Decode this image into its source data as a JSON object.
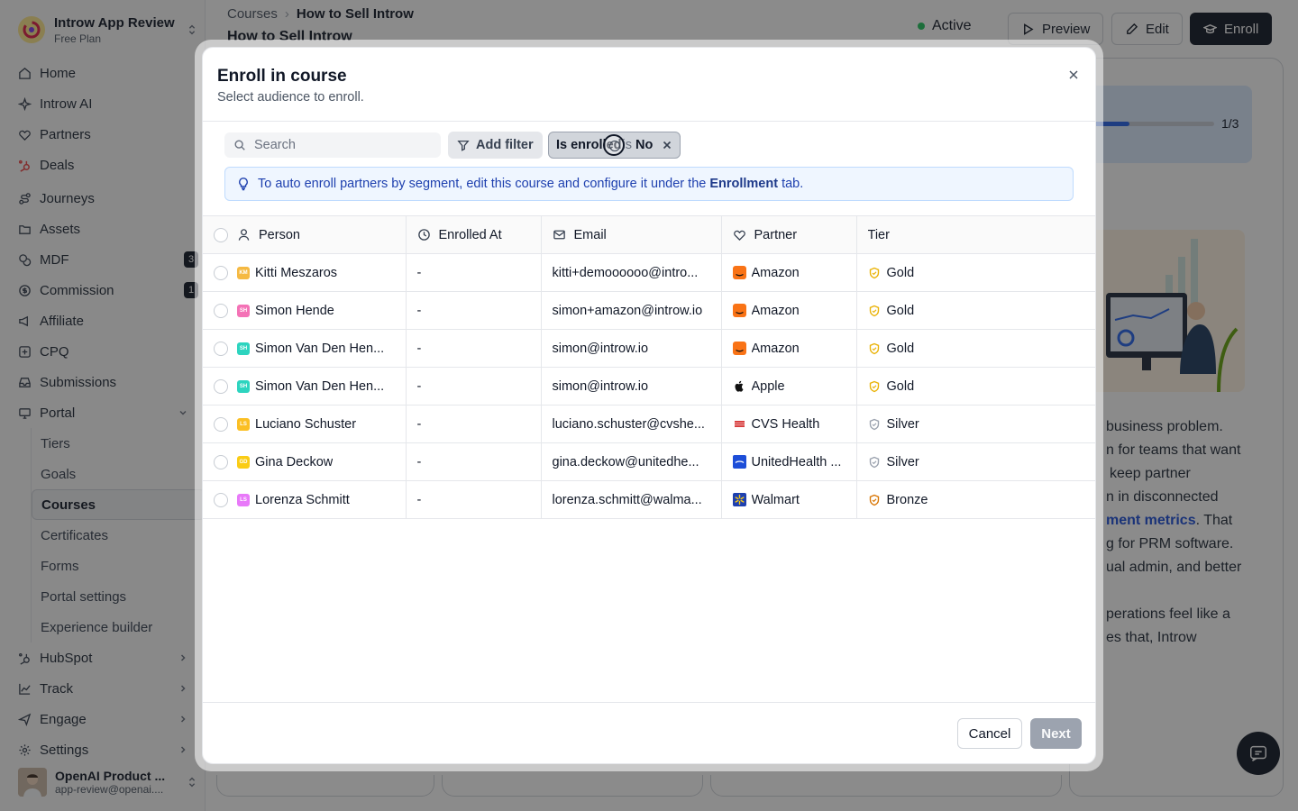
{
  "workspace": {
    "name": "Introw App Review",
    "plan": "Free Plan"
  },
  "sidebar": {
    "items": [
      {
        "label": "Home",
        "icon": "home-icon"
      },
      {
        "label": "Introw AI",
        "icon": "sparkle-icon"
      },
      {
        "label": "Partners",
        "icon": "handshake-icon"
      },
      {
        "label": "Deals",
        "icon": "hubspot-icon"
      },
      {
        "label": "Journeys",
        "icon": "route-icon"
      },
      {
        "label": "Assets",
        "icon": "folder-icon"
      },
      {
        "label": "MDF",
        "icon": "coins-icon",
        "badge": "3"
      },
      {
        "label": "Commission",
        "icon": "dollar-icon",
        "badge": "1"
      },
      {
        "label": "Affiliate",
        "icon": "megaphone-icon"
      },
      {
        "label": "CPQ",
        "icon": "cpq-icon"
      },
      {
        "label": "Submissions",
        "icon": "inbox-icon"
      },
      {
        "label": "Portal",
        "icon": "monitor-icon"
      }
    ],
    "portal_sub": [
      "Tiers",
      "Goals",
      "Courses",
      "Certificates",
      "Forms",
      "Portal settings",
      "Experience builder"
    ],
    "bottom_items": [
      {
        "label": "HubSpot",
        "icon": "hubspot-icon"
      },
      {
        "label": "Track",
        "icon": "chart-icon"
      },
      {
        "label": "Engage",
        "icon": "send-icon"
      },
      {
        "label": "Settings",
        "icon": "gear-icon"
      }
    ],
    "user": {
      "name": "OpenAI Product ...",
      "email": "app-review@openai...."
    }
  },
  "header": {
    "breadcrumb_root": "Courses",
    "breadcrumb_current": "How to Sell Introw",
    "title": "How to Sell Introw",
    "status": "Active",
    "preview_label": "Preview",
    "edit_label": "Edit",
    "enroll_label": "Enroll"
  },
  "background": {
    "progress_label": "1/3",
    "progress": 0.33,
    "lines": [
      "business problem.",
      "n for teams that want",
      "keep partner",
      "n in disconnected"
    ],
    "line5_link": "ment metrics",
    "line5_rest": ". That",
    "lines_after": [
      "g for PRM software.",
      "ual admin, and better",
      "",
      "perations feel like a",
      "es that, Introw"
    ]
  },
  "modal": {
    "title": "Enroll in course",
    "subtitle": "Select audience to enroll.",
    "search_placeholder": "Search",
    "add_filter_label": "Add filter",
    "filter": {
      "key": "Is enrolled",
      "op": "is",
      "value": "No"
    },
    "info_prefix": "To auto enroll partners by segment, edit this course and configure it under the",
    "info_link": "Enrollment",
    "info_suffix": "tab.",
    "columns": [
      "Person",
      "Enrolled At",
      "Email",
      "Partner",
      "Tier"
    ],
    "rows": [
      {
        "initials": "KM",
        "color": "#f5b942",
        "person": "Kitti Meszaros",
        "enrolled": "-",
        "email": "kitti+demoooooo@intro...",
        "partner": "Amazon",
        "plogo": "amazon",
        "tier": "Gold"
      },
      {
        "initials": "SH",
        "color": "#f472b6",
        "person": "Simon Hende",
        "enrolled": "-",
        "email": "simon+amazon@introw.io",
        "partner": "Amazon",
        "plogo": "amazon",
        "tier": "Gold"
      },
      {
        "initials": "SH",
        "color": "#2dd4bf",
        "person": "Simon Van Den Hen...",
        "enrolled": "-",
        "email": "simon@introw.io",
        "partner": "Amazon",
        "plogo": "amazon",
        "tier": "Gold"
      },
      {
        "initials": "SH",
        "color": "#2dd4bf",
        "person": "Simon Van Den Hen...",
        "enrolled": "-",
        "email": "simon@introw.io",
        "partner": "Apple",
        "plogo": "apple",
        "tier": "Gold"
      },
      {
        "initials": "LS",
        "color": "#fbbf24",
        "person": "Luciano Schuster",
        "enrolled": "-",
        "email": "luciano.schuster@cvshe...",
        "partner": "CVS Health",
        "plogo": "cvs",
        "tier": "Silver"
      },
      {
        "initials": "GD",
        "color": "#facc15",
        "person": "Gina Deckow",
        "enrolled": "-",
        "email": "gina.deckow@unitedhe...",
        "partner": "UnitedHealth ...",
        "plogo": "uhg",
        "tier": "Silver"
      },
      {
        "initials": "LS",
        "color": "#e879f9",
        "person": "Lorenza Schmitt",
        "enrolled": "-",
        "email": "lorenza.schmitt@walma...",
        "partner": "Walmart",
        "plogo": "walmart",
        "tier": "Bronze"
      }
    ],
    "cancel_label": "Cancel",
    "next_label": "Next"
  },
  "colors": {
    "accent": "#111827",
    "info_bg": "#eff6ff",
    "info_text": "#1e40af",
    "gold": "#eab308",
    "silver": "#9ca3af",
    "bronze": "#d97706",
    "active": "#22c55e"
  }
}
